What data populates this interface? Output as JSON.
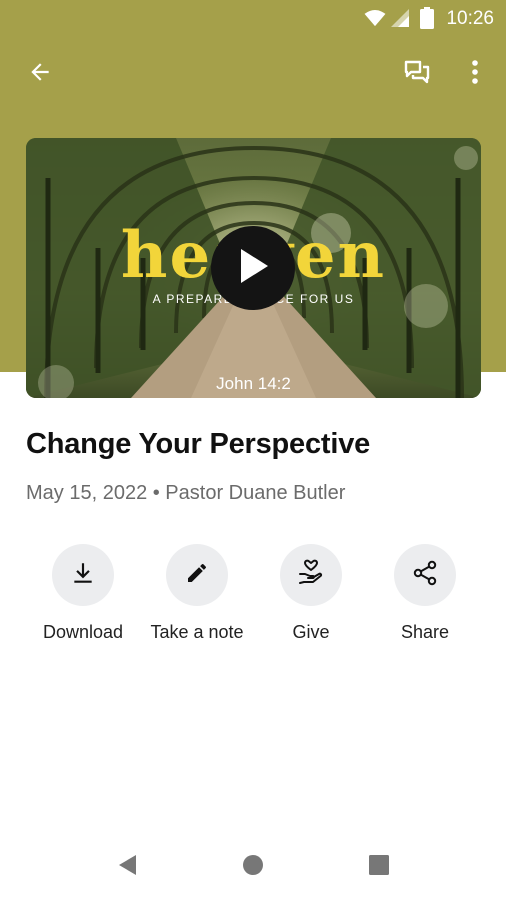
{
  "status_bar": {
    "time": "10:26",
    "icons": [
      "wifi-icon",
      "cellular-signal-icon",
      "battery-icon"
    ]
  },
  "app_bar": {
    "back_icon": "arrow-back-icon",
    "actions": [
      "chat-icon",
      "more-vert-icon"
    ]
  },
  "video": {
    "title_text": "heaven",
    "subtitle_text": "A PREPARED PLACE FOR US",
    "verse_text": "John 14:2",
    "play_icon": "play-icon"
  },
  "sermon": {
    "title": "Change Your Perspective",
    "meta": "May 15, 2022 • Pastor Duane Butler"
  },
  "actions": [
    {
      "label": "Download",
      "icon": "download-icon"
    },
    {
      "label": "Take a note",
      "icon": "pencil-icon"
    },
    {
      "label": "Give",
      "icon": "hand-heart-icon"
    },
    {
      "label": "Share",
      "icon": "share-icon"
    }
  ],
  "nav_bar": {
    "buttons": [
      "nav-back-icon",
      "nav-home-icon",
      "nav-recents-icon"
    ]
  },
  "colors": {
    "header": "#a5a04a",
    "accent_yellow": "#f2d53a",
    "action_bg": "#ecedef",
    "meta_text": "#6b6b6b"
  }
}
